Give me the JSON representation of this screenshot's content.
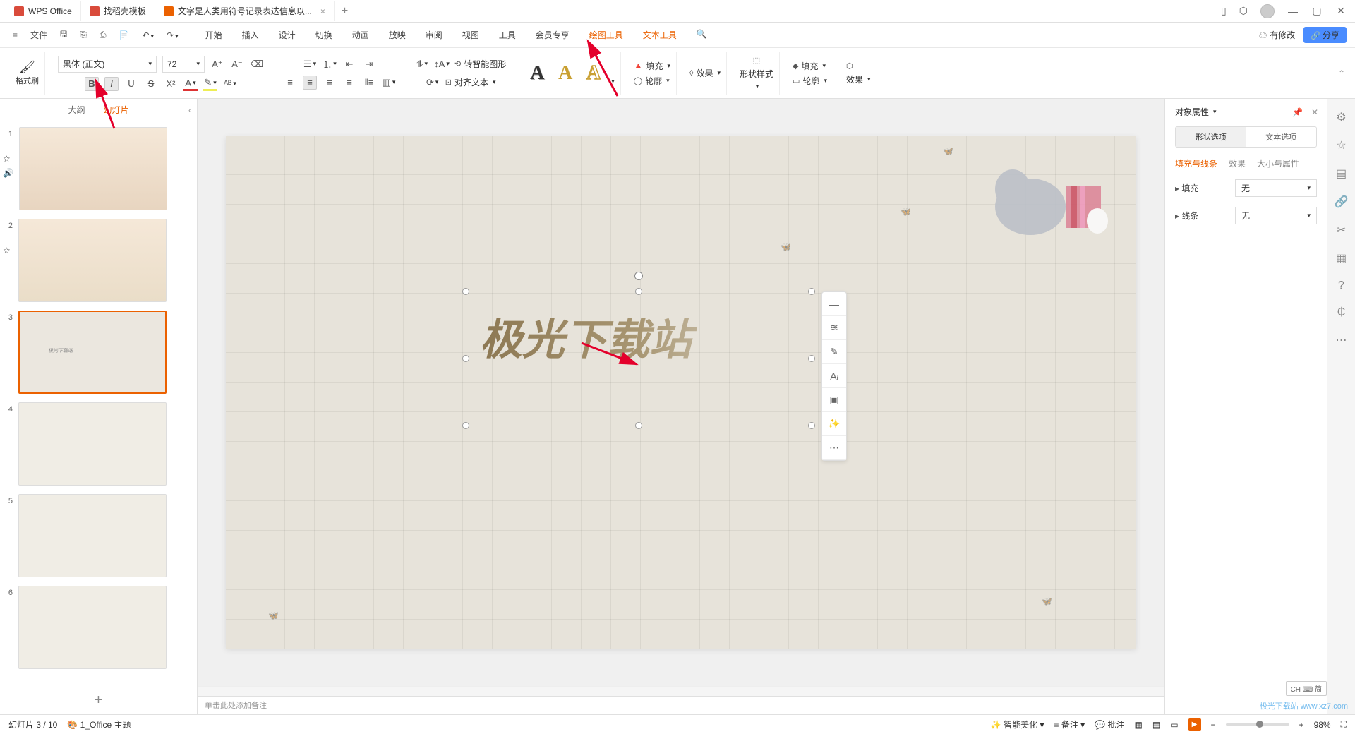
{
  "titlebar": {
    "tabs": [
      {
        "icon": "wps",
        "label": "WPS Office"
      },
      {
        "icon": "doc",
        "label": "找稻壳模板"
      },
      {
        "icon": "ppt",
        "label": "文字是人类用符号记录表达信息以..."
      }
    ],
    "add": "+"
  },
  "menubar": {
    "file": "文件",
    "tabs": [
      "开始",
      "插入",
      "设计",
      "切换",
      "动画",
      "放映",
      "审阅",
      "视图",
      "工具",
      "会员专享",
      "绘图工具",
      "文本工具"
    ],
    "highlight_indices": [
      10,
      11
    ],
    "modified": "有修改",
    "share": "分享"
  },
  "ribbon": {
    "format_brush": "格式刷",
    "font_name": "黑体 (正文)",
    "font_size": "72",
    "wordart_glyph": "A",
    "fill": "填充",
    "outline": "轮廓",
    "effects": "效果",
    "shape_style": "形状样式",
    "shape_fill": "填充",
    "shape_outline": "轮廓",
    "shape_effects": "效果",
    "smart_graphic": "转智能图形",
    "align_text": "对齐文本"
  },
  "outline": {
    "tab_outline": "大纲",
    "tab_slides": "幻灯片",
    "add": "+"
  },
  "canvas": {
    "main_text": "极光下载站",
    "notes_placeholder": "单击此处添加备注"
  },
  "props": {
    "title": "对象属性",
    "tab_shape": "形状选项",
    "tab_text": "文本选项",
    "sub_fill": "填充与线条",
    "sub_effects": "效果",
    "sub_size": "大小与属性",
    "fill_label": "填充",
    "fill_value": "无",
    "line_label": "线条",
    "line_value": "无"
  },
  "statusbar": {
    "slide_pos": "幻灯片 3 / 10",
    "theme": "1_Office 主题",
    "beautify": "智能美化",
    "notes": "备注",
    "comments": "批注",
    "zoom": "98%"
  },
  "ime": "CH ⌨ 简",
  "watermark": "极光下载站 www.xz7.com"
}
